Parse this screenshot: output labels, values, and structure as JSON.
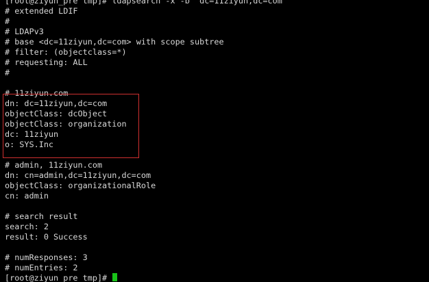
{
  "terminal": {
    "colors": {
      "background": "#000000",
      "text": "#d8d8d8",
      "highlight_border": "#d03030",
      "cursor": "#19c219"
    },
    "lines": [
      "[root@ziyun_pre tmp]# ldapsearch -x -b 'dc=11ziyun,dc=com'",
      "# extended LDIF",
      "#",
      "# LDAPv3",
      "# base <dc=11ziyun,dc=com> with scope subtree",
      "# filter: (objectclass=*)",
      "# requesting: ALL",
      "#",
      "",
      "# 11ziyun.com",
      "dn: dc=11ziyun,dc=com",
      "objectClass: dcObject",
      "objectClass: organization",
      "dc: 11ziyun",
      "o: SYS.Inc",
      "",
      "# admin, 11ziyun.com",
      "dn: cn=admin,dc=11ziyun,dc=com",
      "objectClass: organizationalRole",
      "cn: admin",
      "",
      "# search result",
      "search: 2",
      "result: 0 Success",
      "",
      "# numResponses: 3",
      "# numEntries: 2",
      "[root@ziyun_pre tmp]# "
    ],
    "cursor_icon": "block-cursor-icon"
  }
}
